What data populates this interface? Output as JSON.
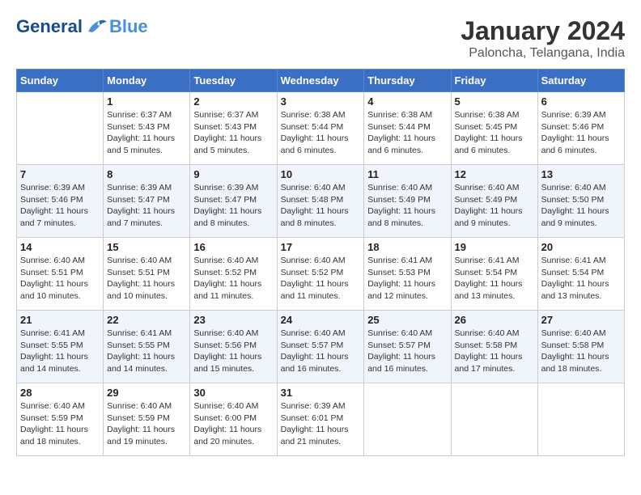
{
  "logo": {
    "part1": "General",
    "part2": "Blue"
  },
  "title": "January 2024",
  "subtitle": "Paloncha, Telangana, India",
  "headers": [
    "Sunday",
    "Monday",
    "Tuesday",
    "Wednesday",
    "Thursday",
    "Friday",
    "Saturday"
  ],
  "weeks": [
    [
      {
        "day": "",
        "sunrise": "",
        "sunset": "",
        "daylight": ""
      },
      {
        "day": "1",
        "sunrise": "Sunrise: 6:37 AM",
        "sunset": "Sunset: 5:43 PM",
        "daylight": "Daylight: 11 hours and 5 minutes."
      },
      {
        "day": "2",
        "sunrise": "Sunrise: 6:37 AM",
        "sunset": "Sunset: 5:43 PM",
        "daylight": "Daylight: 11 hours and 5 minutes."
      },
      {
        "day": "3",
        "sunrise": "Sunrise: 6:38 AM",
        "sunset": "Sunset: 5:44 PM",
        "daylight": "Daylight: 11 hours and 6 minutes."
      },
      {
        "day": "4",
        "sunrise": "Sunrise: 6:38 AM",
        "sunset": "Sunset: 5:44 PM",
        "daylight": "Daylight: 11 hours and 6 minutes."
      },
      {
        "day": "5",
        "sunrise": "Sunrise: 6:38 AM",
        "sunset": "Sunset: 5:45 PM",
        "daylight": "Daylight: 11 hours and 6 minutes."
      },
      {
        "day": "6",
        "sunrise": "Sunrise: 6:39 AM",
        "sunset": "Sunset: 5:46 PM",
        "daylight": "Daylight: 11 hours and 6 minutes."
      }
    ],
    [
      {
        "day": "7",
        "sunrise": "Sunrise: 6:39 AM",
        "sunset": "Sunset: 5:46 PM",
        "daylight": "Daylight: 11 hours and 7 minutes."
      },
      {
        "day": "8",
        "sunrise": "Sunrise: 6:39 AM",
        "sunset": "Sunset: 5:47 PM",
        "daylight": "Daylight: 11 hours and 7 minutes."
      },
      {
        "day": "9",
        "sunrise": "Sunrise: 6:39 AM",
        "sunset": "Sunset: 5:47 PM",
        "daylight": "Daylight: 11 hours and 8 minutes."
      },
      {
        "day": "10",
        "sunrise": "Sunrise: 6:40 AM",
        "sunset": "Sunset: 5:48 PM",
        "daylight": "Daylight: 11 hours and 8 minutes."
      },
      {
        "day": "11",
        "sunrise": "Sunrise: 6:40 AM",
        "sunset": "Sunset: 5:49 PM",
        "daylight": "Daylight: 11 hours and 8 minutes."
      },
      {
        "day": "12",
        "sunrise": "Sunrise: 6:40 AM",
        "sunset": "Sunset: 5:49 PM",
        "daylight": "Daylight: 11 hours and 9 minutes."
      },
      {
        "day": "13",
        "sunrise": "Sunrise: 6:40 AM",
        "sunset": "Sunset: 5:50 PM",
        "daylight": "Daylight: 11 hours and 9 minutes."
      }
    ],
    [
      {
        "day": "14",
        "sunrise": "Sunrise: 6:40 AM",
        "sunset": "Sunset: 5:51 PM",
        "daylight": "Daylight: 11 hours and 10 minutes."
      },
      {
        "day": "15",
        "sunrise": "Sunrise: 6:40 AM",
        "sunset": "Sunset: 5:51 PM",
        "daylight": "Daylight: 11 hours and 10 minutes."
      },
      {
        "day": "16",
        "sunrise": "Sunrise: 6:40 AM",
        "sunset": "Sunset: 5:52 PM",
        "daylight": "Daylight: 11 hours and 11 minutes."
      },
      {
        "day": "17",
        "sunrise": "Sunrise: 6:40 AM",
        "sunset": "Sunset: 5:52 PM",
        "daylight": "Daylight: 11 hours and 11 minutes."
      },
      {
        "day": "18",
        "sunrise": "Sunrise: 6:41 AM",
        "sunset": "Sunset: 5:53 PM",
        "daylight": "Daylight: 11 hours and 12 minutes."
      },
      {
        "day": "19",
        "sunrise": "Sunrise: 6:41 AM",
        "sunset": "Sunset: 5:54 PM",
        "daylight": "Daylight: 11 hours and 13 minutes."
      },
      {
        "day": "20",
        "sunrise": "Sunrise: 6:41 AM",
        "sunset": "Sunset: 5:54 PM",
        "daylight": "Daylight: 11 hours and 13 minutes."
      }
    ],
    [
      {
        "day": "21",
        "sunrise": "Sunrise: 6:41 AM",
        "sunset": "Sunset: 5:55 PM",
        "daylight": "Daylight: 11 hours and 14 minutes."
      },
      {
        "day": "22",
        "sunrise": "Sunrise: 6:41 AM",
        "sunset": "Sunset: 5:55 PM",
        "daylight": "Daylight: 11 hours and 14 minutes."
      },
      {
        "day": "23",
        "sunrise": "Sunrise: 6:40 AM",
        "sunset": "Sunset: 5:56 PM",
        "daylight": "Daylight: 11 hours and 15 minutes."
      },
      {
        "day": "24",
        "sunrise": "Sunrise: 6:40 AM",
        "sunset": "Sunset: 5:57 PM",
        "daylight": "Daylight: 11 hours and 16 minutes."
      },
      {
        "day": "25",
        "sunrise": "Sunrise: 6:40 AM",
        "sunset": "Sunset: 5:57 PM",
        "daylight": "Daylight: 11 hours and 16 minutes."
      },
      {
        "day": "26",
        "sunrise": "Sunrise: 6:40 AM",
        "sunset": "Sunset: 5:58 PM",
        "daylight": "Daylight: 11 hours and 17 minutes."
      },
      {
        "day": "27",
        "sunrise": "Sunrise: 6:40 AM",
        "sunset": "Sunset: 5:58 PM",
        "daylight": "Daylight: 11 hours and 18 minutes."
      }
    ],
    [
      {
        "day": "28",
        "sunrise": "Sunrise: 6:40 AM",
        "sunset": "Sunset: 5:59 PM",
        "daylight": "Daylight: 11 hours and 18 minutes."
      },
      {
        "day": "29",
        "sunrise": "Sunrise: 6:40 AM",
        "sunset": "Sunset: 5:59 PM",
        "daylight": "Daylight: 11 hours and 19 minutes."
      },
      {
        "day": "30",
        "sunrise": "Sunrise: 6:40 AM",
        "sunset": "Sunset: 6:00 PM",
        "daylight": "Daylight: 11 hours and 20 minutes."
      },
      {
        "day": "31",
        "sunrise": "Sunrise: 6:39 AM",
        "sunset": "Sunset: 6:01 PM",
        "daylight": "Daylight: 11 hours and 21 minutes."
      },
      {
        "day": "",
        "sunrise": "",
        "sunset": "",
        "daylight": ""
      },
      {
        "day": "",
        "sunrise": "",
        "sunset": "",
        "daylight": ""
      },
      {
        "day": "",
        "sunrise": "",
        "sunset": "",
        "daylight": ""
      }
    ]
  ]
}
